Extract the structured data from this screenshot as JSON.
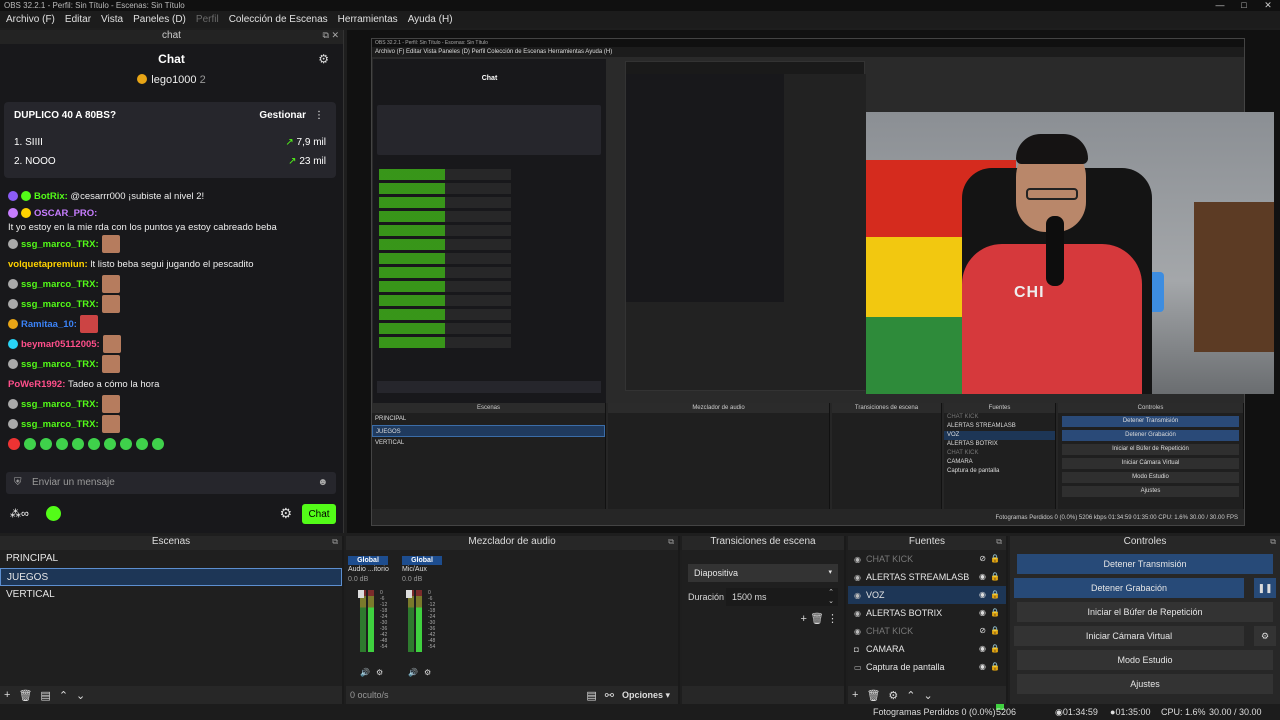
{
  "window": {
    "title": "OBS 32.2.1 - Perfil: Sin Título - Escenas: Sin Título",
    "controls": [
      "—",
      "□",
      "✕"
    ]
  },
  "menu": {
    "items": [
      "Archivo (F)",
      "Editar",
      "Vista",
      "Paneles (D)",
      "Perfil",
      "Colección de Escenas",
      "Herramientas",
      "Ayuda (H)"
    ]
  },
  "chat": {
    "dock_title": "chat",
    "header": "Chat",
    "pinned_user": "lego1000",
    "pinned_count": "2",
    "poll": {
      "question": "DUPLICO 40 A 80BS?",
      "manage_label": "Gestionar",
      "more_label": "⋮",
      "options": [
        {
          "label": "1. SIIII",
          "votes": "7,9 mil"
        },
        {
          "label": "2. NOOO",
          "votes": "23 mil"
        }
      ]
    },
    "messages": [
      {
        "user": "BotRix:",
        "text": "@cesarrr000 ¡subiste al nivel 2!",
        "color": "u-green"
      },
      {
        "user": "OSCAR_PRO:",
        "text": "It yo estoy en la mie rda con los puntos ya estoy cabreado beba",
        "color": "u-green"
      },
      {
        "user": "ssg_marco_TRX:",
        "text": "",
        "color": "u-green"
      },
      {
        "user": "volquetapremiun:",
        "text": "lt listo beba segui jugando el pescadito",
        "color": "u-yellow"
      },
      {
        "user": "ssg_marco_TRX:",
        "text": "",
        "color": "u-green"
      },
      {
        "user": "ssg_marco_TRX:",
        "text": "",
        "color": "u-green"
      },
      {
        "user": "Ramitaa_10:",
        "text": "",
        "color": "u-blue"
      },
      {
        "user": "beymar05112005:",
        "text": "",
        "color": "u-pink"
      },
      {
        "user": "ssg_marco_TRX:",
        "text": "",
        "color": "u-green"
      },
      {
        "user": "PoWeR1992:",
        "text": "Tadeo a cómo la hora",
        "color": "u-pink"
      },
      {
        "user": "ssg_marco_TRX:",
        "text": "",
        "color": "u-green"
      },
      {
        "user": "ssg_marco_TRX:",
        "text": "",
        "color": "u-green"
      }
    ],
    "input_placeholder": "Enviar un mensaje",
    "send_label": "Chat"
  },
  "preview": {
    "nested_title": "OBS 32.2.1 - Perfil: Sin Título - Escenas: Sin Título",
    "nested_menu": "Archivo (F)   Editar   Vista   Paneles (D)   Perfil   Colección de Escenas   Herramientas   Ayuda (H)",
    "nested_chat_header": "Chat",
    "nested_docks": {
      "scenes": "Escenas",
      "mixer": "Mezclador de audio",
      "transitions": "Transiciones de escena",
      "sources": "Fuentes",
      "controls": "Controles",
      "scene_rows": [
        "PRINCIPAL",
        "JUEGOS",
        "VERTICAL"
      ],
      "source_rows": [
        "CHAT KICK",
        "ALERTAS STREAMLASB",
        "VOZ",
        "ALERTAS BOTRIX",
        "CHAT KICK",
        "CAMARA",
        "Captura de pantalla"
      ],
      "control_rows": [
        "Detener Transmisión",
        "Detener Grabación",
        "Iniciar el Búfer de Repetición",
        "Iniciar Cámara Virtual",
        "Modo Estudio",
        "Ajustes"
      ],
      "status": "Fotogramas Perdidos 0 (0.0%)   5206 kbps   01:34:59   01:35:00   CPU: 1.6%   30.00 / 30.00 FPS"
    },
    "webcam_shirt_text": "CHI"
  },
  "scenes": {
    "title": "Escenas",
    "items": [
      "PRINCIPAL",
      "JUEGOS",
      "VERTICAL"
    ],
    "selected": 1
  },
  "mixer": {
    "title": "Mezclador de audio",
    "channels": [
      {
        "name": "Global",
        "source": "Audio ...itorio",
        "db": "0.0 dB"
      },
      {
        "name": "Global",
        "source": "Mic/Aux",
        "db": "0.0 dB"
      }
    ],
    "ticks": [
      "0",
      "-6",
      "-12",
      "-18",
      "-24",
      "-30",
      "-36",
      "-42",
      "-48",
      "-54",
      "-60"
    ],
    "hidden": "0 oculto/s",
    "options_label": "Opciones"
  },
  "transitions": {
    "title": "Transiciones de escena",
    "selected": "Diapositiva",
    "duration_label": "Duración",
    "duration_value": "1500 ms"
  },
  "sources": {
    "title": "Fuentes",
    "items": [
      {
        "name": "CHAT KICK",
        "icon": "globe-icon",
        "visible": false
      },
      {
        "name": "ALERTAS STREAMLASB",
        "icon": "globe-icon",
        "visible": true
      },
      {
        "name": "VOZ",
        "icon": "globe-icon",
        "visible": true
      },
      {
        "name": "ALERTAS BOTRIX",
        "icon": "globe-icon",
        "visible": true
      },
      {
        "name": "CHAT KICK",
        "icon": "globe-icon",
        "visible": false
      },
      {
        "name": "CAMARA",
        "icon": "camera-icon",
        "visible": true
      },
      {
        "name": "Captura de pantalla",
        "icon": "monitor-icon",
        "visible": true
      }
    ],
    "selected": 2
  },
  "controls": {
    "title": "Controles",
    "stop_stream": "Detener Transmisión",
    "stop_record": "Detener Grabación",
    "replay_buffer": "Iniciar el Búfer de Repetición",
    "virtual_cam": "Iniciar Cámara Virtual",
    "studio_mode": "Modo Estudio",
    "settings": "Ajustes"
  },
  "status": {
    "dropped": "Fotogramas Perdidos 0 (0.0%)",
    "kbps": "5206 kbps",
    "stream_time": "01:34:59",
    "rec_time": "01:35:00",
    "cpu": "CPU: 1.6%",
    "fps": "30.00 / 30.00 FPS"
  }
}
